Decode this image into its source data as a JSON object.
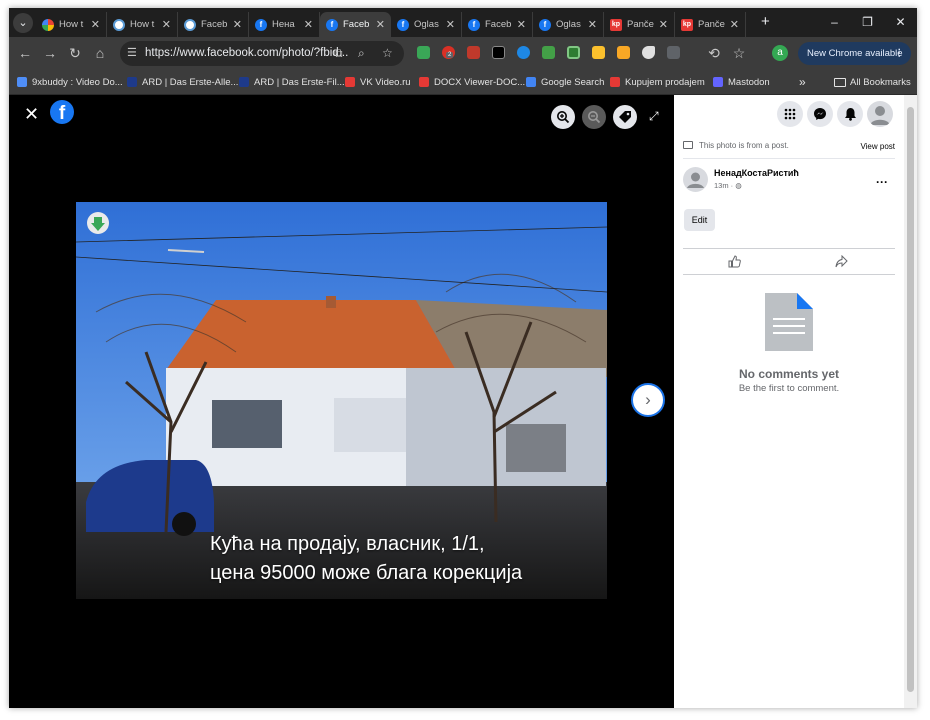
{
  "browser": {
    "tabs": [
      {
        "title": "How t",
        "favicon": "google-icon",
        "active": false
      },
      {
        "title": "How t",
        "favicon": "ring-icon",
        "active": false
      },
      {
        "title": "Faceb",
        "favicon": "ring-icon",
        "active": false
      },
      {
        "title": "Нена",
        "favicon": "facebook-icon",
        "active": false
      },
      {
        "title": "Faceb",
        "favicon": "facebook-icon",
        "active": true
      },
      {
        "title": "Oglas",
        "favicon": "facebook-icon",
        "active": false
      },
      {
        "title": "Faceb",
        "favicon": "facebook-icon",
        "active": false
      },
      {
        "title": "Oglas",
        "favicon": "facebook-icon",
        "active": false
      },
      {
        "title": "Panče",
        "favicon": "kp-icon",
        "active": false
      },
      {
        "title": "Panče",
        "favicon": "kp-icon",
        "active": false
      }
    ],
    "url": "https://www.facebook.com/photo/?fbid...",
    "extension_badge": "2",
    "profile_letter": "a",
    "new_chrome_label": "New Chrome available",
    "bookmarks": [
      {
        "label": "9xbuddy : Video Do...",
        "color": "#4f8ef7"
      },
      {
        "label": "ARD | Das Erste-Alle...",
        "color": "#1e3a8a"
      },
      {
        "label": "ARD | Das Erste-Fil...",
        "color": "#1e3a8a"
      },
      {
        "label": "VK Video.ru",
        "color": "#e53935"
      },
      {
        "label": "DOCX Viewer-DOC...",
        "color": "#e53935"
      },
      {
        "label": "Google Search",
        "color": "#4285f4"
      },
      {
        "label": "Kupujem prodajem",
        "color": "#e53935"
      },
      {
        "label": "Mastodon",
        "color": "#6364ff"
      }
    ],
    "bookmarks_overflow": "»",
    "all_bookmarks_label": "All Bookmarks"
  },
  "viewer": {
    "caption_line1": "Кућа на продају, власник, 1/1,",
    "caption_line2": "цена 95000 може блага корекција"
  },
  "panel": {
    "photo_from_post": "This photo is from a post.",
    "view_post": "View post",
    "author_name": "НенадКостаРистић",
    "post_time": "13m ·",
    "edit_label": "Edit",
    "no_comments_title": "No comments yet",
    "no_comments_sub": "Be the first to comment."
  },
  "colors": {
    "facebook_blue": "#1877f2",
    "accent_blue": "#1a73e8"
  }
}
